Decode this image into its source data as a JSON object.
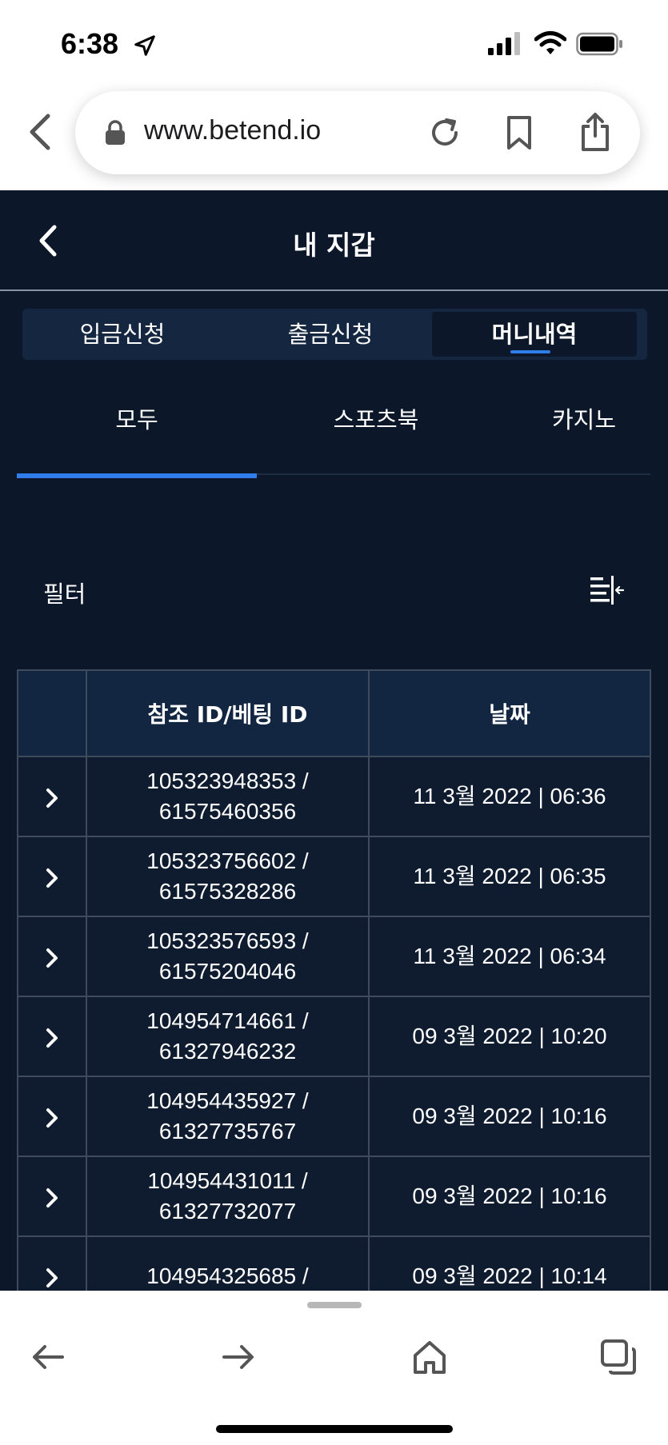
{
  "status_bar": {
    "time": "6:38",
    "icons": [
      "location-arrow-icon",
      "cellular-signal-icon",
      "wifi-icon",
      "battery-icon"
    ]
  },
  "browser": {
    "url": "www.betend.io",
    "icons": [
      "back-chevron-icon",
      "lock-icon",
      "reload-icon",
      "bookmark-icon",
      "share-icon"
    ],
    "bottom_icons": [
      "back-arrow-icon",
      "forward-arrow-icon",
      "home-icon",
      "tabs-icon"
    ]
  },
  "header": {
    "title": "내 지갑",
    "back_icon": "chevron-left-icon"
  },
  "segment": {
    "items": [
      {
        "label": "입금신청",
        "active": false
      },
      {
        "label": "출금신청",
        "active": false
      },
      {
        "label": "머니내역",
        "active": true
      }
    ]
  },
  "subtabs": {
    "items": [
      {
        "label": "모두",
        "active": true
      },
      {
        "label": "스포츠북",
        "active": false
      },
      {
        "label": "카지노",
        "active": false
      }
    ]
  },
  "filter": {
    "label": "필터",
    "icon": "filter-collapse-icon"
  },
  "table": {
    "headers": [
      "",
      "참조 ID/베팅 ID",
      "날짜"
    ],
    "rows": [
      {
        "ref": "105323948353 /",
        "bet": "61575460356",
        "date": "11 3월 2022 | 06:36"
      },
      {
        "ref": "105323756602 /",
        "bet": "61575328286",
        "date": "11 3월 2022 | 06:35"
      },
      {
        "ref": "105323576593 /",
        "bet": "61575204046",
        "date": "11 3월 2022 | 06:34"
      },
      {
        "ref": "104954714661 /",
        "bet": "61327946232",
        "date": "09 3월 2022 | 10:20"
      },
      {
        "ref": "104954435927 /",
        "bet": "61327735767",
        "date": "09 3월 2022 | 10:16"
      },
      {
        "ref": "104954431011 /",
        "bet": "61327732077",
        "date": "09 3월 2022 | 10:16"
      },
      {
        "ref": "104954325685 /",
        "bet": "",
        "date": "09 3월 2022 | 10:14"
      }
    ]
  },
  "colors": {
    "app_bg": "#0c1829",
    "accent": "#2f7dea",
    "segment_bg": "#142640",
    "table_header_bg": "#122541",
    "border": "#3f4a5c"
  }
}
